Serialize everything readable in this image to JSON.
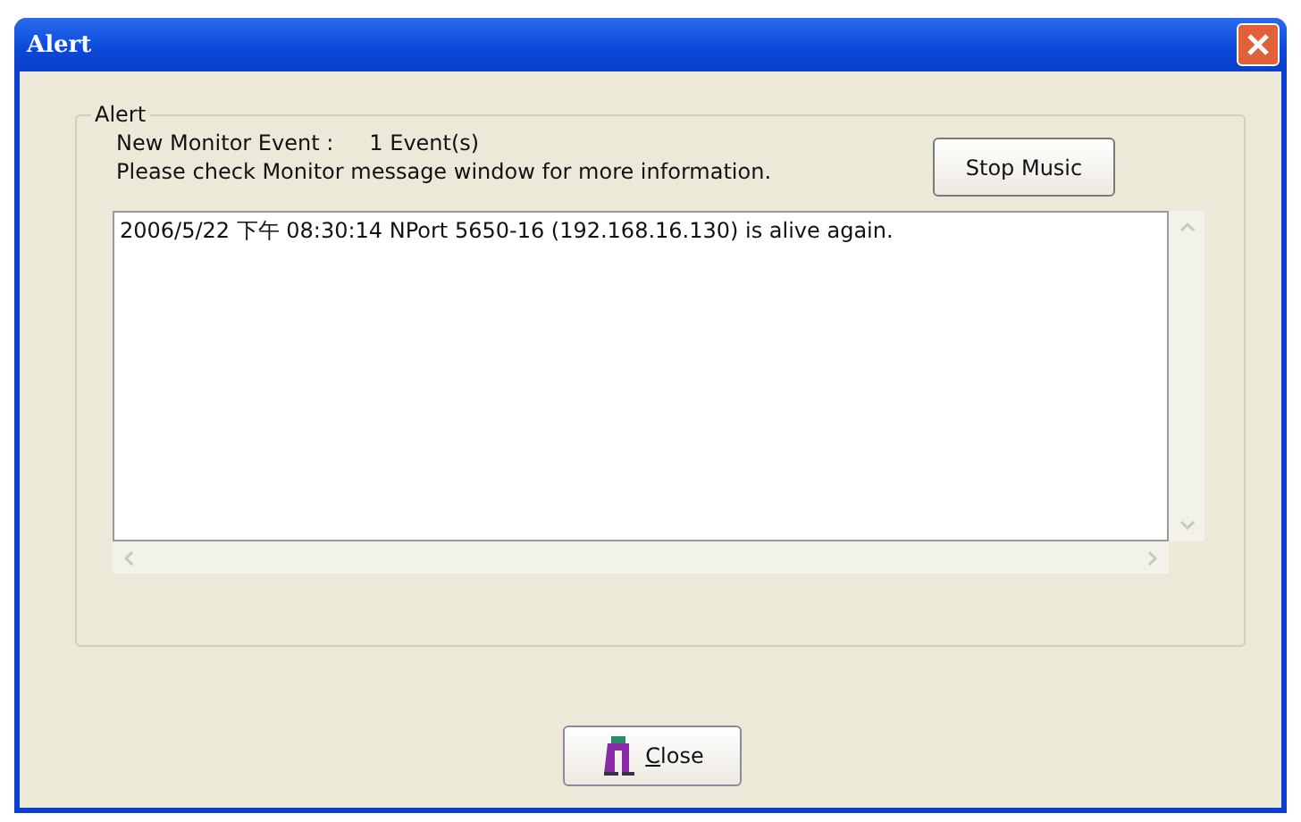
{
  "window": {
    "title": "Alert"
  },
  "group": {
    "title": "Alert",
    "event_label": "New Monitor Event :",
    "event_count": "1 Event(s)",
    "message": "Please check Monitor message window for more information.",
    "stop_button": "Stop Music"
  },
  "log": {
    "lines": [
      "2006/5/22 下午 08:30:14 NPort 5650-16 (192.168.16.130) is alive again."
    ]
  },
  "buttons": [
    {
      "label": "Close"
    }
  ]
}
